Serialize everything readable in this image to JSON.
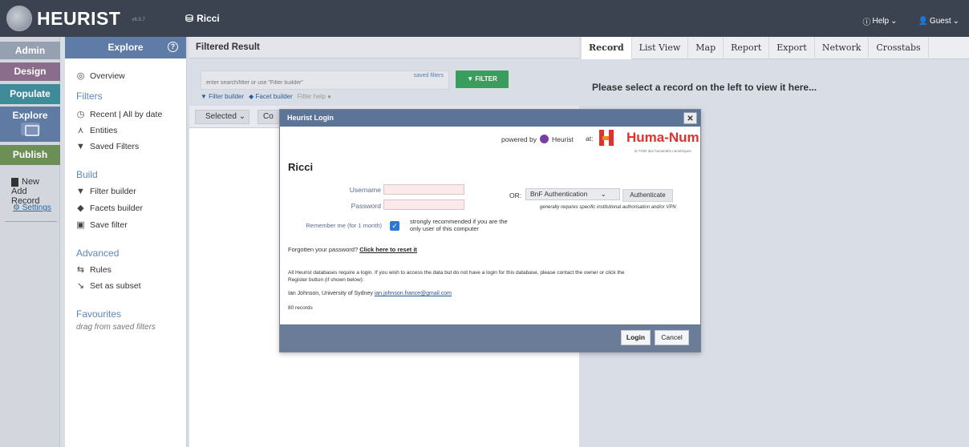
{
  "header": {
    "app_name": "HEURIST",
    "version": "v6.5.7",
    "db_name": "Ricci",
    "help": "Help",
    "user": "Guest"
  },
  "leftnav": {
    "admin": "Admin",
    "design": "Design",
    "populate": "Populate",
    "explore": "Explore",
    "publish": "Publish",
    "new_record_line1": "New",
    "new_record_line2": "Add Record",
    "settings": "Settings"
  },
  "sidebar": {
    "title": "Explore",
    "overview": "Overview",
    "filters_heading": "Filters",
    "recent": "Recent | All by date",
    "entities": "Entities",
    "saved_filters": "Saved Filters",
    "build_heading": "Build",
    "filter_builder": "Filter builder",
    "facets_builder": "Facets builder",
    "save_filter": "Save filter",
    "advanced_heading": "Advanced",
    "rules": "Rules",
    "set_as_subset": "Set as subset",
    "favourites_heading": "Favourites",
    "favourites_sub": "drag from saved filters"
  },
  "result": {
    "title": "Filtered Result",
    "search_placeholder": "enter search/filter or use \"Filter builder\"",
    "saved_filters": "saved filters",
    "filter_btn": "FILTER",
    "filter_builder": "Filter builder",
    "facet_builder": "Facet builder",
    "filter_help": "Filter help",
    "selected": "Selected",
    "co": "Co"
  },
  "record": {
    "tabs": [
      "Record",
      "List View",
      "Map",
      "Report",
      "Export",
      "Network",
      "Crosstabs"
    ],
    "message": "Please select a record on the left to view it here..."
  },
  "login": {
    "title": "Heurist Login",
    "powered_by": "powered by",
    "heurist": "Heurist",
    "at": "at:",
    "humanum": "Huma-Num",
    "humanum_sub": "la TGIR des humanités numériques",
    "db": "Ricci",
    "username_label": "Username",
    "password_label": "Password",
    "remember": "Remember me (for 1 month)",
    "strongly": "strongly recommended if you are the only user of this computer",
    "or": "OR:",
    "bnf": "BnF Authentication",
    "authenticate": "Authenticate",
    "note": "generally requires specific institutional authorisation and/or VPN",
    "forgot_text": "Forgotten your password?",
    "forgot_link": "Click here to reset it",
    "info": "All Heurist databases require a login. If you wish to access the data but do not have a login for this database, please contact the owner or click the Register button (if shown below):",
    "owner": "Ian Johnson, University of Sydney",
    "owner_email": "ian.johnson.france@gmail.com",
    "records": "80 records",
    "login_btn": "Login",
    "cancel_btn": "Cancel"
  }
}
